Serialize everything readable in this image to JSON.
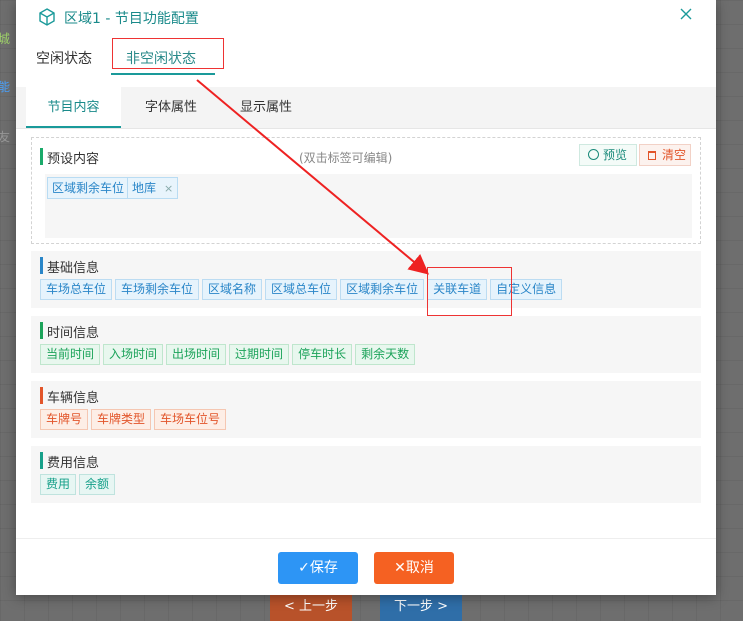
{
  "background": {
    "left_fragments": [
      "城",
      "能",
      "友"
    ],
    "prev_button": "< 上一步",
    "next_button": "下一步 >"
  },
  "dialog": {
    "title": "区域1 - 节目功能配置",
    "top_tabs": [
      "空闲状态",
      "非空闲状态"
    ],
    "active_top_tab": "非空闲状态",
    "sub_tabs": [
      "节目内容",
      "字体属性",
      "显示属性"
    ],
    "active_sub_tab": "节目内容",
    "preset": {
      "label": "预设内容",
      "hint": "(双击标签可编辑)",
      "preview_label": "预览",
      "clear_label": "清空",
      "tags": [
        "区域剩余车位",
        "地库"
      ]
    },
    "groups": [
      {
        "label": "基础信息",
        "color": "#2a86c8",
        "tags": [
          "车场总车位",
          "车场剩余车位",
          "区域名称",
          "区域总车位",
          "区域剩余车位",
          "关联车道",
          "自定义信息"
        ]
      },
      {
        "label": "时间信息",
        "color": "#1ca35a",
        "tags": [
          "当前时间",
          "入场时间",
          "出场时间",
          "过期时间",
          "停车时长",
          "剩余天数"
        ]
      },
      {
        "label": "车辆信息",
        "color": "#e2552a",
        "tags": [
          "车牌号",
          "车牌类型",
          "车场车位号"
        ]
      },
      {
        "label": "费用信息",
        "color": "#17a08a",
        "tags": [
          "费用",
          "余额"
        ]
      }
    ],
    "save_label": "保存",
    "cancel_label": "取消"
  }
}
